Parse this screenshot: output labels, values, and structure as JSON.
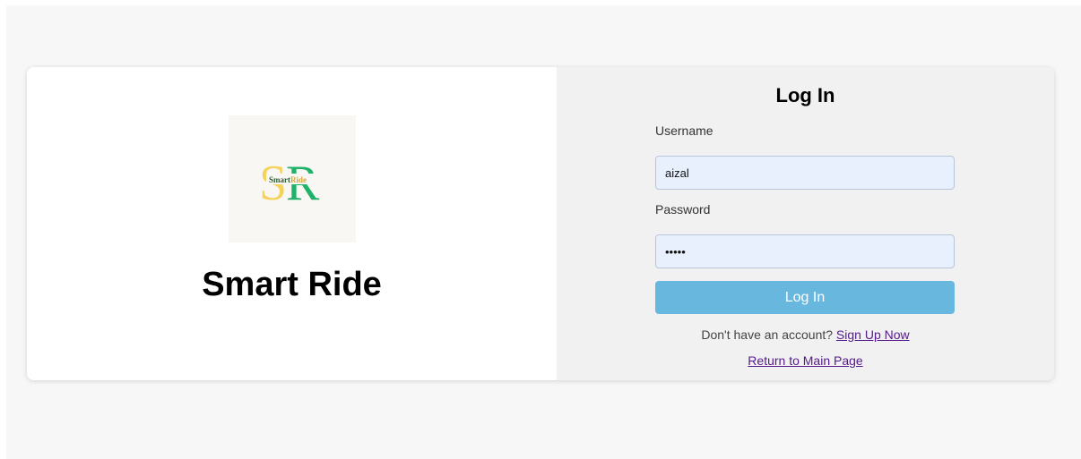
{
  "brand": {
    "logo_text": "SmartRide",
    "logo_text_part1": "Smart",
    "logo_text_part2": "Ride",
    "name": "Smart Ride",
    "colors": {
      "logo_yellow": "#f5d35a",
      "logo_green": "#1fb36a",
      "logo_brown": "#2f5e35"
    }
  },
  "login": {
    "title": "Log In",
    "username_label": "Username",
    "username_value": "aizal",
    "password_label": "Password",
    "password_value": "aizal",
    "submit_label": "Log In",
    "signup_prompt": "Don't have an account?",
    "signup_link": "Sign Up Now",
    "return_link": "Return to Main Page"
  },
  "colors": {
    "button": "#67b7de",
    "input_bg": "#e8f0fe",
    "link": "#551a8b"
  }
}
